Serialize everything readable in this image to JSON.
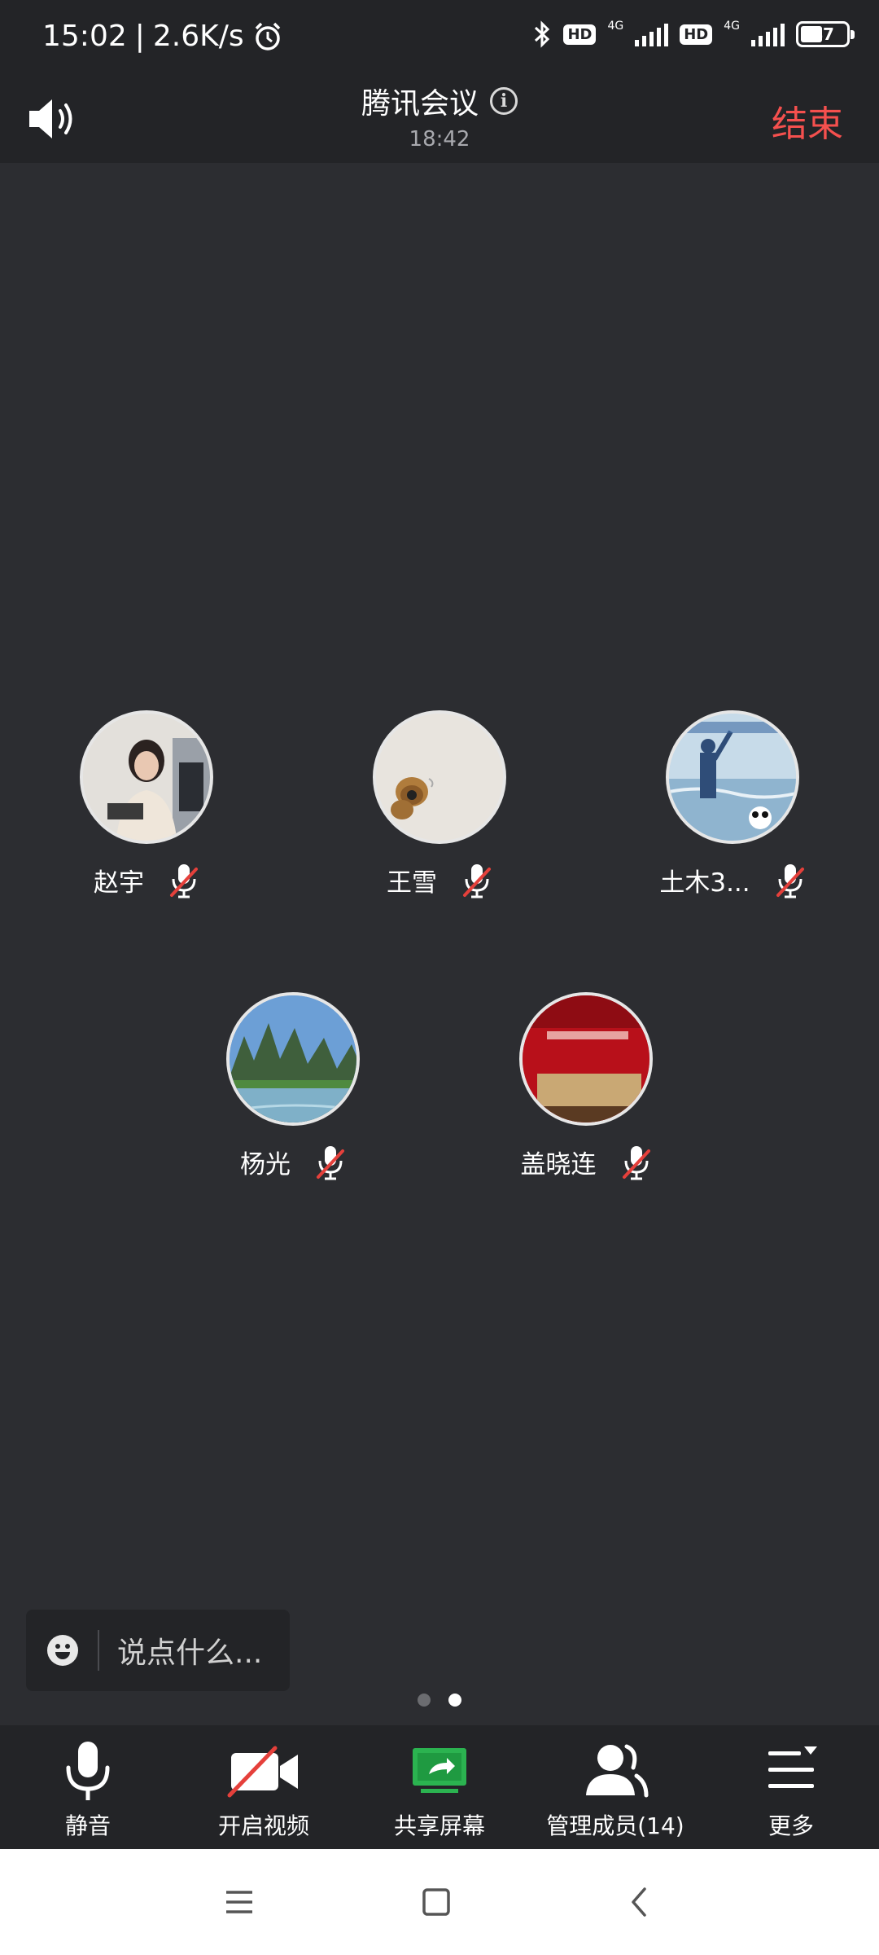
{
  "status_bar": {
    "time": "15:02",
    "separator": "|",
    "net_speed": "2.6K/s",
    "hd1": "HD",
    "hd2": "HD",
    "net1": "4G",
    "net2": "4G",
    "battery": "47",
    "icons": [
      "alarm-icon",
      "bluetooth-icon",
      "signal-icon",
      "battery-icon"
    ]
  },
  "header": {
    "title": "腾讯会议",
    "timer": "18:42",
    "end_label": "结束"
  },
  "participants": [
    {
      "name": "赵宇",
      "muted": true,
      "avatar": "woman-at-desk-photo"
    },
    {
      "name": "王雪",
      "muted": true,
      "avatar": "bear-toy-photo"
    },
    {
      "name": "土木3...",
      "muted": true,
      "avatar": "together-for-a-shared-future-photo"
    },
    {
      "name": "杨光",
      "muted": true,
      "avatar": "karst-mountains-river-photo"
    },
    {
      "name": "盖晓连",
      "muted": true,
      "avatar": "red-banner-stage-photo"
    }
  ],
  "chat": {
    "placeholder": "说点什么..."
  },
  "pager": {
    "count": 2,
    "active_index": 1
  },
  "toolbar": {
    "mute_label": "静音",
    "video_label": "开启视频",
    "share_label": "共享屏幕",
    "members_label": "管理成员(14)",
    "more_label": "更多"
  },
  "colors": {
    "background": "#2c2d31",
    "bar": "#232427",
    "end_red": "#f5504e",
    "share_green": "#2bb350",
    "mute_red": "#e5403b"
  }
}
